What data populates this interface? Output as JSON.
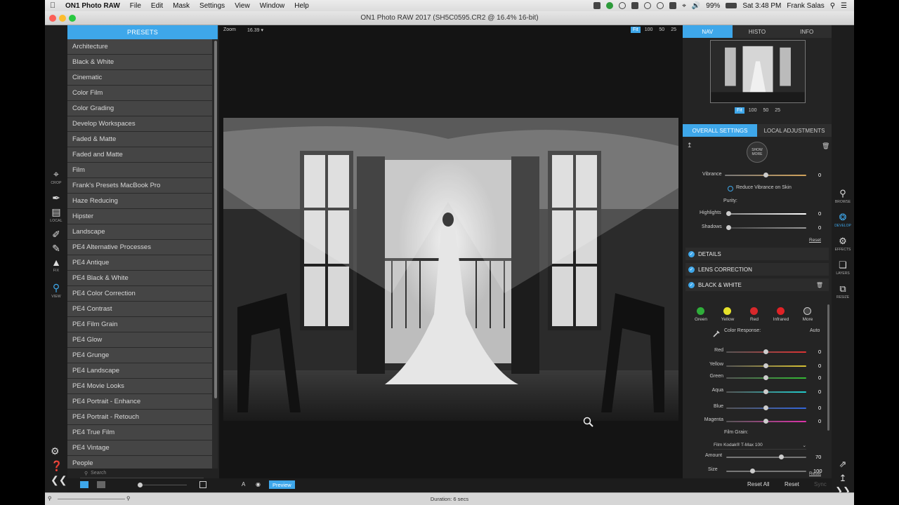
{
  "menubar": {
    "app_name": "ON1 Photo RAW",
    "menus": [
      "File",
      "Edit",
      "Mask",
      "Settings",
      "View",
      "Window",
      "Help"
    ],
    "battery": "99%",
    "time": "Sat 3:48 PM",
    "user": "Frank Salas"
  },
  "window": {
    "title": "ON1 Photo RAW 2017 (SH5C0595.CR2 @ 16.4% 16-bit)"
  },
  "tools": [
    "CROP",
    "LOCAL",
    "FIX",
    "VIEW"
  ],
  "presets": {
    "header": "PRESETS",
    "items": [
      "Architecture",
      "Black & White",
      "Cinematic",
      "Color Film",
      "Color Grading",
      "Develop Workspaces",
      "Faded & Matte",
      "Faded and Matte",
      "Film",
      "Frank's Presets MacBook Pro",
      "Haze Reducing",
      "Hipster",
      "Landscape",
      "PE4 Alternative Processes",
      "PE4 Antique",
      "PE4 Black & White",
      "PE4 Color Correction",
      "PE4 Contrast",
      "PE4 Film Grain",
      "PE4 Glow",
      "PE4 Grunge",
      "PE4 Landscape",
      "PE4 Movie Looks",
      "PE4 Portrait - Enhance",
      "PE4 Portrait - Retouch",
      "PE4 True Film",
      "PE4 Vintage",
      "People"
    ],
    "search_placeholder": "Search"
  },
  "canvas": {
    "zoom_label": "Zoom",
    "zoom_value": "16.39",
    "zoom_options": [
      "Fit",
      "100",
      "50",
      "25"
    ],
    "selected_zoom": "Fit"
  },
  "bottombar": {
    "preview_label": "Preview",
    "reset_all": "Reset All",
    "reset": "Reset",
    "sync": "Sync"
  },
  "status": {
    "duration": "Duration: 6 secs"
  },
  "rpanel": {
    "tabs": [
      "NAV",
      "HISTO",
      "INFO"
    ],
    "selected_tab": "NAV",
    "nav_zoom_options": [
      "Fit",
      "100",
      "50",
      "25"
    ],
    "subtabs": [
      "OVERALL SETTINGS",
      "LOCAL ADJUSTMENTS"
    ],
    "show_more": "SHOW MORE",
    "vibrance": {
      "label": "Vibrance",
      "value": "0",
      "checkbox": "Reduce Vibrance on Skin"
    },
    "purity": {
      "label": "Purity:",
      "highlights_label": "Highlights",
      "highlights_value": "0",
      "shadows_label": "Shadows",
      "shadows_value": "0"
    },
    "reset_label": "Reset",
    "sections": [
      "DETAILS",
      "LENS CORRECTION",
      "BLACK & WHITE"
    ],
    "bw": {
      "swatches": [
        {
          "name": "Green",
          "color": "#2fae3a"
        },
        {
          "name": "Yellow",
          "color": "#e6e22a"
        },
        {
          "name": "Red",
          "color": "#d8282b"
        },
        {
          "name": "Infrared",
          "color": "#e02226"
        },
        {
          "name": "More",
          "color": "#444444"
        }
      ],
      "color_response_label": "Color Response:",
      "auto_label": "Auto",
      "sliders": [
        {
          "label": "Red",
          "value": "0"
        },
        {
          "label": "Yellow",
          "value": "0"
        },
        {
          "label": "Green",
          "value": "0"
        },
        {
          "label": "Aqua",
          "value": "0"
        },
        {
          "label": "Blue",
          "value": "0"
        },
        {
          "label": "Magenta",
          "value": "0"
        }
      ],
      "film_grain_label": "Film Grain:",
      "film_label": "Film",
      "film_value": "Kodak® T-Max 100",
      "amount_label": "Amount",
      "amount_value": "70",
      "size_label": "Size",
      "size_value": "100"
    }
  },
  "modules": [
    "BROWSE",
    "DEVELOP",
    "EFFECTS",
    "LAYERS",
    "RESIZE"
  ],
  "accent_color": "#3ea7ea"
}
